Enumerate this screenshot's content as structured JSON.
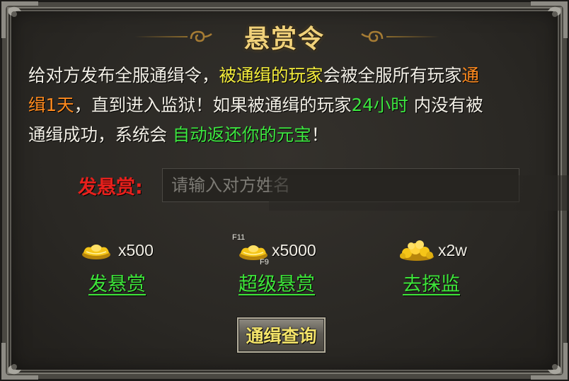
{
  "title": "悬赏令",
  "description": {
    "p1": "给对方发布全服通缉令，",
    "p2": "被通缉的玩家",
    "p3": "会被全服所有玩家",
    "p4": "通",
    "p5": "缉1天",
    "p6": "，直到进入监狱！如果被通缉的玩家",
    "p7": "24小时",
    "p8": "内没有被",
    "p9": "通缉成功，系统会",
    "p10": "自动返还你的元宝",
    "p11": "！"
  },
  "bounty": {
    "label": "发悬赏:",
    "placeholder": "请输入对方姓名"
  },
  "options": [
    {
      "icon": "gold-ingot-icon",
      "amount": "x500",
      "link": "发悬赏"
    },
    {
      "icon": "gold-ingot-icon",
      "amount": "x5000",
      "link": "超级悬赏",
      "hotkeys": [
        "F11",
        "F9"
      ]
    },
    {
      "icon": "gold-pile-icon",
      "amount": "x2w",
      "link": "去探监"
    }
  ],
  "query_button": "通缉查询",
  "colors": {
    "title": "#f0d17a",
    "yellow": "#f4ed3c",
    "orange": "#ff8a1e",
    "green": "#3de640",
    "red": "#e8201c"
  }
}
